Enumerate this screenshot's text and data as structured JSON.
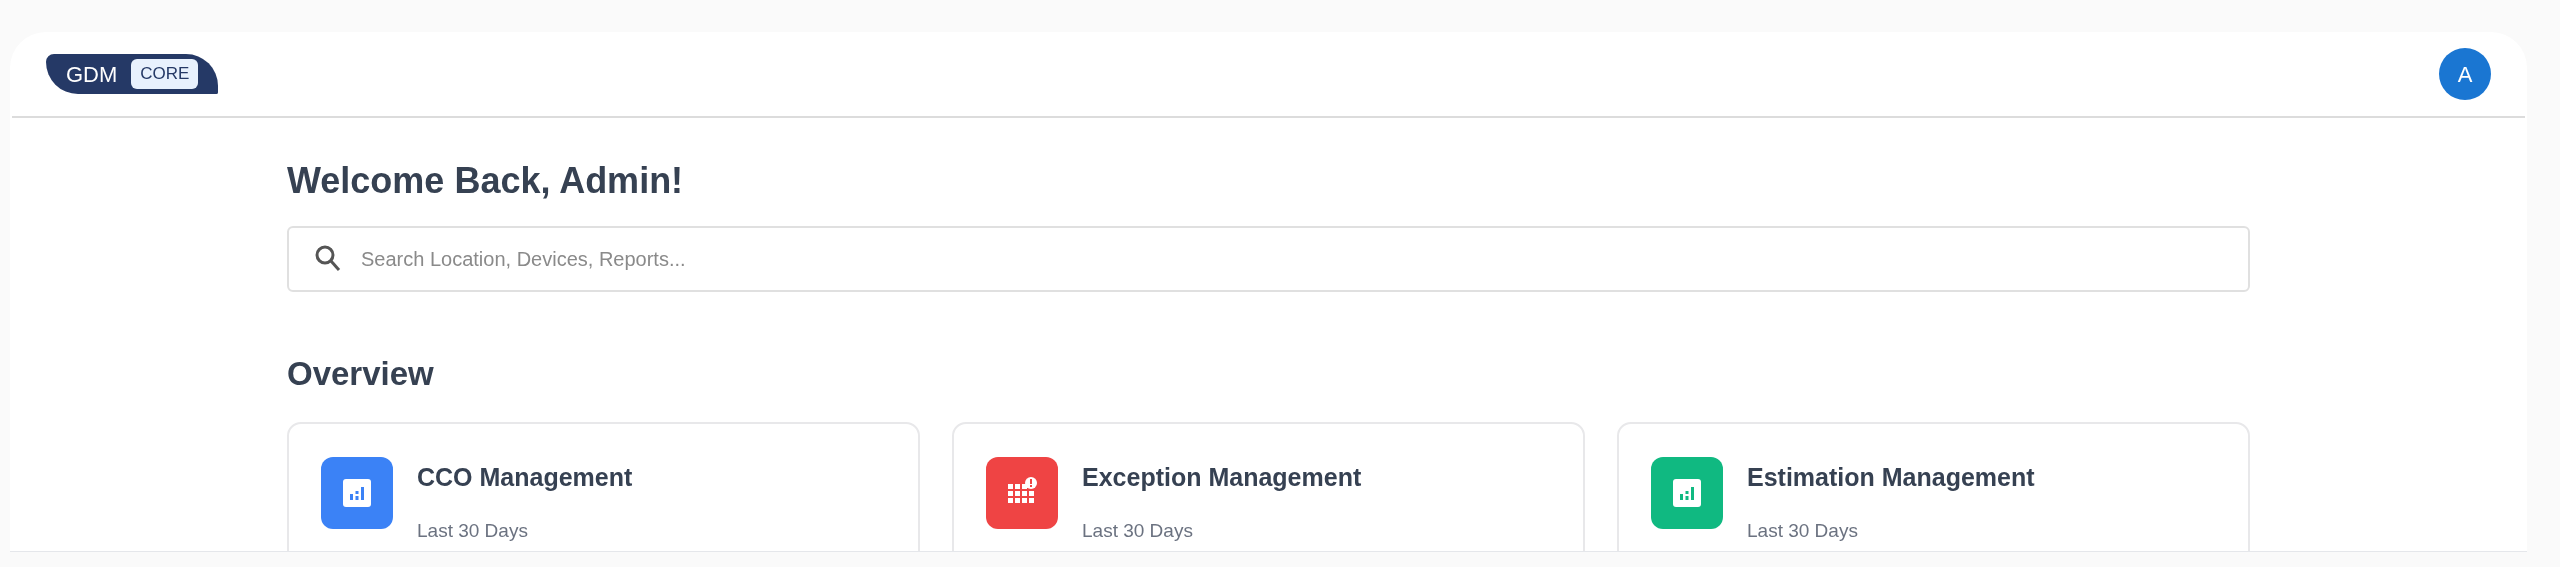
{
  "header": {
    "logo": {
      "name": "GDM",
      "badge": "CORE"
    },
    "avatar": "A"
  },
  "welcome": "Welcome Back, Admin!",
  "search": {
    "placeholder": "Search Location, Devices, Reports..."
  },
  "overview": {
    "title": "Overview",
    "cards": [
      {
        "title": "CCO Management",
        "subtitle": "Last 30 Days",
        "kind": "chart",
        "color": "#3b82f6"
      },
      {
        "title": "Exception Management",
        "subtitle": "Last 30 Days",
        "kind": "alert-grid",
        "color": "#ef4444"
      },
      {
        "title": "Estimation Management",
        "subtitle": "Last 30 Days",
        "kind": "chart",
        "color": "#10b981"
      }
    ]
  }
}
